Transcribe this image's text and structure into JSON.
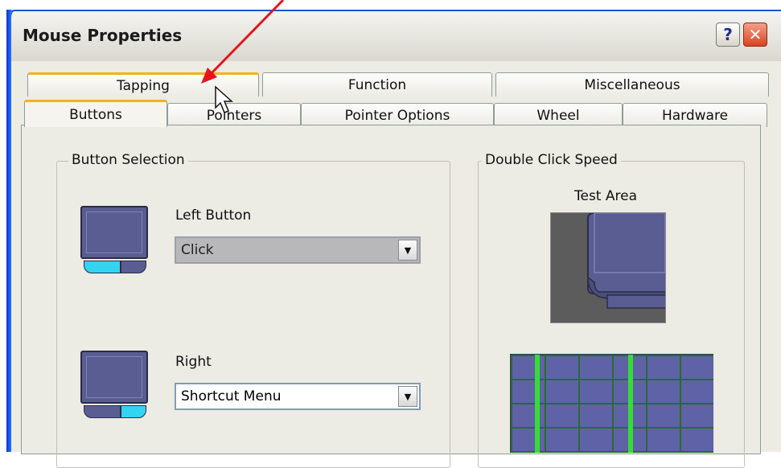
{
  "window": {
    "title": "Mouse Properties",
    "help_label": "?",
    "close_label": "✕"
  },
  "tabs_back": [
    {
      "label": "Tapping"
    },
    {
      "label": "Function"
    },
    {
      "label": "Miscellaneous"
    }
  ],
  "tabs_front": [
    {
      "label": "Buttons",
      "selected": true
    },
    {
      "label": "Pointers"
    },
    {
      "label": "Pointer Options"
    },
    {
      "label": "Wheel"
    },
    {
      "label": "Hardware"
    }
  ],
  "button_selection": {
    "group_label": "Button Selection",
    "left": {
      "label": "Left Button",
      "value": "Click",
      "disabled": true
    },
    "right": {
      "label": "Right",
      "value": "Shortcut Menu"
    }
  },
  "double_click": {
    "group_label": "Double Click Speed",
    "test_area_label": "Test Area"
  },
  "icons": {
    "help": "question-icon",
    "close": "close-icon",
    "dropdown": "chevron-down-icon",
    "cursor": "mouse-pointer-icon",
    "annotation": "red-arrow"
  },
  "colors": {
    "tab_highlight": "#f5b022",
    "touchpad_screen": "#5a5d92",
    "touchpad_active_button": "#33d4f0",
    "annotation_arrow": "#e8121b",
    "grid_bar": "#33dd33"
  }
}
